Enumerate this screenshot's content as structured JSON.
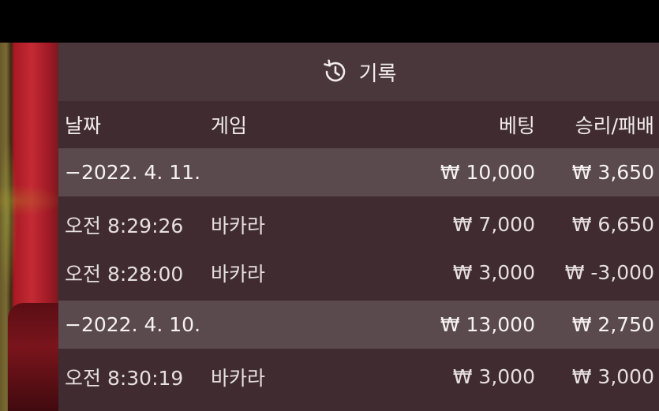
{
  "header": {
    "title": "기록",
    "icon": "history-icon"
  },
  "columns": {
    "date": "날짜",
    "game": "게임",
    "bet": "베팅",
    "winloss": "승리/패배"
  },
  "rows": [
    {
      "type": "group",
      "date": "−2022. 4. 11.",
      "game": "",
      "bet": "₩ 10,000",
      "winloss": "₩ 3,650"
    },
    {
      "type": "item",
      "date": "오전 8:29:26",
      "game": "바카라",
      "bet": "₩ 7,000",
      "winloss": "₩ 6,650"
    },
    {
      "type": "item",
      "date": "오전 8:28:00",
      "game": "바카라",
      "bet": "₩ 3,000",
      "winloss": "₩ -3,000"
    },
    {
      "type": "group",
      "date": "−2022. 4. 10.",
      "game": "",
      "bet": "₩ 13,000",
      "winloss": "₩ 2,750"
    },
    {
      "type": "item",
      "date": "오전 8:30:19",
      "game": "바카라",
      "bet": "₩ 3,000",
      "winloss": "₩ 3,000"
    }
  ]
}
